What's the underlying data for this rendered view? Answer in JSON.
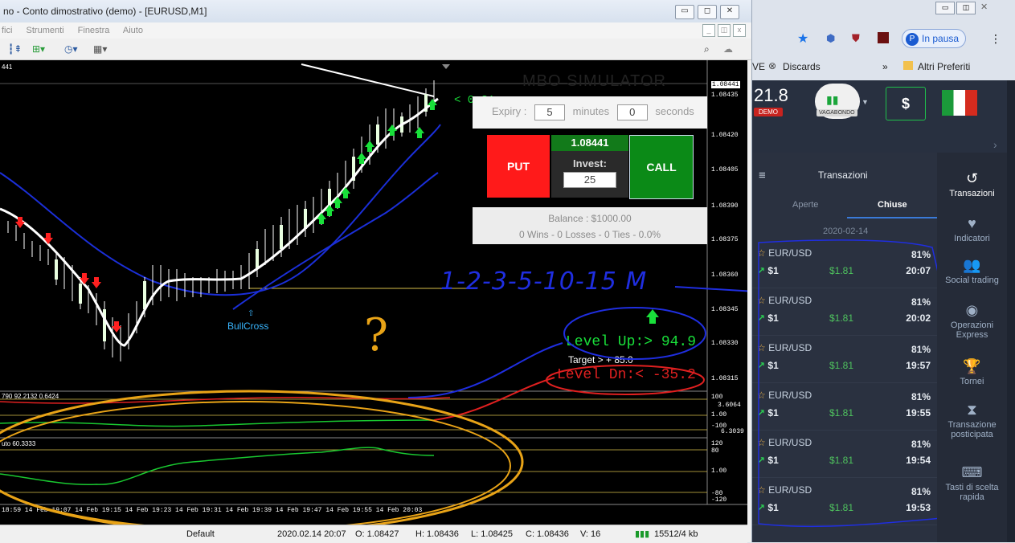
{
  "mt4": {
    "title": "no - Conto dimostrativo (demo) - [EURUSD,M1]",
    "menu": [
      "fici",
      "Strumenti",
      "Finestra",
      "Aiuto"
    ],
    "win_min": "▭",
    "win_max": "◻",
    "win_close": "✕",
    "inner_min": "_",
    "inner_restore": "◫",
    "inner_close": "x",
    "price_tl": "441",
    "price_axis": [
      "1.08441",
      "1.08435",
      "1.08420",
      "1.08405",
      "1.08390",
      "1.08375",
      "1.08360",
      "1.08345",
      "1.08330",
      "1.08315"
    ],
    "ind1_label": "790 92.2132 0.6424",
    "ind1_axis": [
      "100",
      "3.6064",
      "1.00",
      "-100",
      "6.3039"
    ],
    "ind2_label": "uto 60.3333",
    "ind2_axis": [
      "120",
      "80",
      "1.00",
      "-80",
      "-120"
    ],
    "time_axis": "18:59  14 Feb 19:07  14 Feb 19:15  14 Feb 19:23  14 Feb 19:31  14 Feb 19:39  14 Feb 19:47  14 Feb 19:55  14 Feb 20:03",
    "bullcross": "BullCross",
    "timer": "< 0:31",
    "level_up": "Level Up:>  94.9",
    "target": "Target > + 85.0",
    "level_dn": "Level Dn:<  -35.2",
    "handwriting": "1-2-3-5-10-15 M",
    "question": "?",
    "status": {
      "profile": "Default",
      "datetime": "2020.02.14 20:07",
      "open": "O: 1.08427",
      "high": "H: 1.08436",
      "low": "L: 1.08425",
      "close": "C: 1.08436",
      "volume": "V: 16",
      "traffic": "15512/4 kb"
    }
  },
  "mbo": {
    "title": "MBO SIMULATOR",
    "expiry_label": "Expiry :",
    "expiry_minutes": "5",
    "minutes_label": "minutes",
    "expiry_seconds": "0",
    "seconds_label": "seconds",
    "put": "PUT",
    "call": "CALL",
    "price": "1.08441",
    "invest_label": "Invest:",
    "invest_value": "25",
    "balance": "Balance : $1000.00",
    "stats": "0 Wins - 0 Losses - 0 Ties - 0.0%"
  },
  "browser": {
    "paused": "In pausa",
    "bookmark_prefix": "VE",
    "bookmark_discards": "Discards",
    "more": "»",
    "other_bookmarks": "Altri Preferiti",
    "menu_dots": "⋮"
  },
  "platform": {
    "balance": "21.8",
    "demo": "DEMO",
    "account": "VAGABONDO",
    "deposit": "$",
    "transactions_title": "Transazioni",
    "tab_open": "Aperte",
    "tab_closed": "Chiuse",
    "date": "2020-02-14",
    "trades": [
      {
        "pair": "EUR/USD",
        "pct": "81%",
        "inv": "$1",
        "pay": "$1.81",
        "time": "20:07"
      },
      {
        "pair": "EUR/USD",
        "pct": "81%",
        "inv": "$1",
        "pay": "$1.81",
        "time": "20:02"
      },
      {
        "pair": "EUR/USD",
        "pct": "81%",
        "inv": "$1",
        "pay": "$1.81",
        "time": "19:57"
      },
      {
        "pair": "EUR/USD",
        "pct": "81%",
        "inv": "$1",
        "pay": "$1.81",
        "time": "19:55"
      },
      {
        "pair": "EUR/USD",
        "pct": "81%",
        "inv": "$1",
        "pay": "$1.81",
        "time": "19:54"
      },
      {
        "pair": "EUR/USD",
        "pct": "81%",
        "inv": "$1",
        "pay": "$1.81",
        "time": "19:53"
      }
    ],
    "side": [
      {
        "label": "Transazioni",
        "icon": "history-icon"
      },
      {
        "label": "Indicatori",
        "icon": "heartbeat-icon"
      },
      {
        "label": "Social trading",
        "icon": "users-icon"
      },
      {
        "label": "Operazioni Express",
        "icon": "target-icon"
      },
      {
        "label": "Tornei",
        "icon": "trophy-icon"
      },
      {
        "label": "Transazione posticipata",
        "icon": "hourglass-icon"
      },
      {
        "label": "Tasti di scelta rapida",
        "icon": "keyboard-icon"
      }
    ]
  },
  "colors": {
    "put": "#ff1a1a",
    "call": "#0b8a17",
    "annotation_blue": "#1f2ee0",
    "annotation_orange": "#e8a317"
  }
}
